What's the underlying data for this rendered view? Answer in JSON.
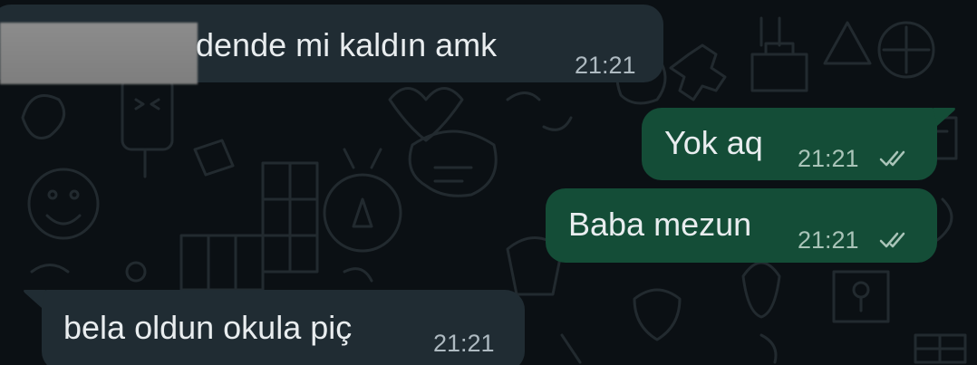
{
  "messages": [
    {
      "direction": "incoming",
      "text": "dende mi kaldın amk",
      "time": "21:21",
      "partially_redacted": true
    },
    {
      "direction": "outgoing",
      "text": "Yok aq",
      "time": "21:21",
      "status_icon": "double-check-read-icon"
    },
    {
      "direction": "outgoing",
      "text": "Baba mezun",
      "time": "21:21",
      "status_icon": "double-check-read-icon"
    },
    {
      "direction": "incoming",
      "text": "bela oldun okula piç",
      "time": "21:21"
    }
  ],
  "colors": {
    "background": "#0b1014",
    "incoming_bubble": "#202c33",
    "outgoing_bubble": "#144d37",
    "text": "#e9edef",
    "timestamp": "#aebac1"
  }
}
